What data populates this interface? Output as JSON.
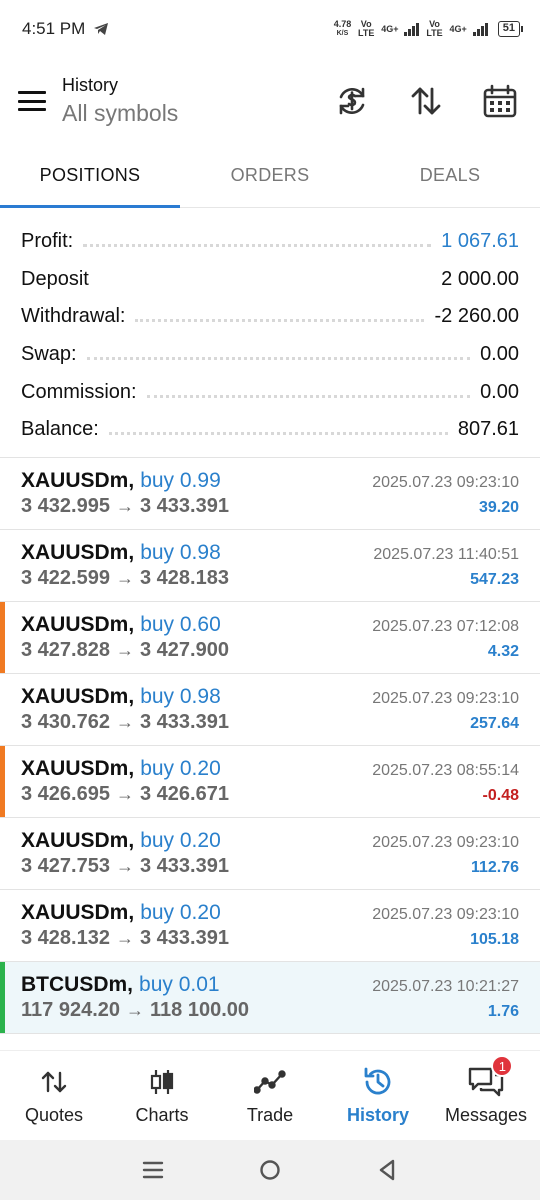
{
  "status_bar": {
    "time": "4:51 PM",
    "net_speed": "4.78",
    "net_unit": "K/S",
    "sim1": "Vo LTE",
    "sim1_net": "4G+",
    "sim2": "Vo LTE",
    "sim2_net": "4G+",
    "battery": "51"
  },
  "header": {
    "title": "History",
    "subtitle": "All symbols"
  },
  "tabs": [
    {
      "label": "POSITIONS",
      "active": true
    },
    {
      "label": "ORDERS",
      "active": false
    },
    {
      "label": "DEALS",
      "active": false
    }
  ],
  "summary": [
    {
      "label": "Profit:",
      "value": "1 067.61"
    },
    {
      "label": "Deposit",
      "value": "2 000.00"
    },
    {
      "label": "Withdrawal:",
      "value": "-2 260.00"
    },
    {
      "label": "Swap:",
      "value": "0.00"
    },
    {
      "label": "Commission:",
      "value": "0.00"
    },
    {
      "label": "Balance:",
      "value": "807.61"
    }
  ],
  "positions": [
    {
      "symbol": "XAUUSDm,",
      "type": "buy 0.99",
      "time": "2025.07.23 09:23:10",
      "open": "3 432.995",
      "close": "3 433.391",
      "profit": "39.20"
    },
    {
      "symbol": "XAUUSDm,",
      "type": "buy 0.98",
      "time": "2025.07.23 11:40:51",
      "open": "3 422.599",
      "close": "3 428.183",
      "profit": "547.23"
    },
    {
      "symbol": "XAUUSDm,",
      "type": "buy 0.60",
      "time": "2025.07.23 07:12:08",
      "open": "3 427.828",
      "close": "3 427.900",
      "profit": "4.32"
    },
    {
      "symbol": "XAUUSDm,",
      "type": "buy 0.98",
      "time": "2025.07.23 09:23:10",
      "open": "3 430.762",
      "close": "3 433.391",
      "profit": "257.64"
    },
    {
      "symbol": "XAUUSDm,",
      "type": "buy 0.20",
      "time": "2025.07.23 08:55:14",
      "open": "3 426.695",
      "close": "3 426.671",
      "profit": "-0.48"
    },
    {
      "symbol": "XAUUSDm,",
      "type": "buy 0.20",
      "time": "2025.07.23 09:23:10",
      "open": "3 427.753",
      "close": "3 433.391",
      "profit": "112.76"
    },
    {
      "symbol": "XAUUSDm,",
      "type": "buy 0.20",
      "time": "2025.07.23 09:23:10",
      "open": "3 428.132",
      "close": "3 433.391",
      "profit": "105.18"
    },
    {
      "symbol": "BTCUSDm,",
      "type": "buy 0.01",
      "time": "2025.07.23 10:21:27",
      "open": "117 924.20",
      "close": "118 100.00",
      "profit": "1.76"
    }
  ],
  "arrow": "→",
  "bottom_nav": [
    {
      "label": "Quotes",
      "icon": "quotes-icon"
    },
    {
      "label": "Charts",
      "icon": "charts-icon"
    },
    {
      "label": "Trade",
      "icon": "trade-icon"
    },
    {
      "label": "History",
      "icon": "history-icon",
      "active": true
    },
    {
      "label": "Messages",
      "icon": "messages-icon",
      "badge": "1"
    }
  ],
  "colors": {
    "accent": "#2a80cc",
    "negative": "#c42020",
    "mark_orange": "#f07a22",
    "mark_green": "#2bb24c"
  }
}
